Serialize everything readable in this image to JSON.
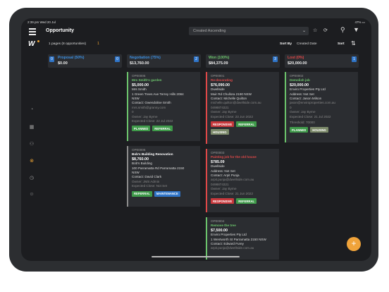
{
  "status": {
    "time_date": "2:39 pm  Wed 20 Jul",
    "right": "47% ▭"
  },
  "header": {
    "title": "Opportunity",
    "sort_select": "Created Ascending"
  },
  "subbar": {
    "pages": "1 pages (8 opportunities)",
    "count": "1",
    "sort_by_label": "Sort By",
    "sort_field": "Created Date",
    "sort_label": "Sort"
  },
  "columns": [
    {
      "name": "Proposal (50%)",
      "amount": "$0.00",
      "count_left": "0",
      "count_right": "0",
      "color": "#3c8fe0"
    },
    {
      "name": "Negotiation (75%)",
      "amount": "$13,760.00",
      "count_left": "",
      "count_right": "2",
      "color": "#3c8fe0"
    },
    {
      "name": "Won (100%)",
      "amount": "$84,375.09",
      "count_left": "",
      "count_right": "3",
      "color": "#6cc46c"
    },
    {
      "name": "Lost (0%)",
      "amount": "$20,000.00",
      "count_left": "",
      "count_right": "1",
      "color": "#e04848"
    }
  ],
  "cards": {
    "c1": {
      "id": "OP00005",
      "title": "Mrs Smith's garden",
      "value": "$5,000.00",
      "l1": "Mrs Smith",
      "l2": "1 Green Trees Ave Terrey Hills 2084",
      "l3": "NSW",
      "l4": "Contact: Gwendoline Smith",
      "l5": "mrs.smith@granny.com",
      "l6": "0",
      "l7": "Owner: Jay Byrne",
      "l8": "Expected Close: 22 Jul 2022",
      "t1": "PLANNED",
      "t2": "REFERRAL"
    },
    "c2": {
      "id": "OP00006",
      "title": "Bob's Building Renovation",
      "value": "$8,760.00",
      "l1": "Bob's Building",
      "l2": "100 Parramatta Rd Parramatta 2150",
      "l3": "NSW",
      "l4": "Contact: David Clark",
      "l5": "Owner: JMS Admin",
      "l6": "Expected Close: Not Set",
      "t1": "REFERRAL",
      "t2": "MAINTENANCE"
    },
    "c3": {
      "id": "OP00001",
      "title": "Re-decorating",
      "value": "$76,090.00",
      "l1": "Dwellside",
      "l2": "Muir Rd Chullora 2190 NSW",
      "l3": "Contact: Michelle Quilton",
      "l4": "michelle.quilton@dwellside.com.au",
      "l5": "0498874321",
      "l6": "Owner: Jay Byrne",
      "l7": "Expected Close: 23 Jun 2022",
      "t1": "RESPONSIVE",
      "t2": "REFERRAL",
      "t3": "HOUSING"
    },
    "c4": {
      "id": "OP00003",
      "title": "Painting job for the old house",
      "value": "$785.09",
      "l1": "Dwellside",
      "l2": "Address: Not Set",
      "l3": "Contact: Arpit Punja",
      "l4": "arpit.punja@dwellside.com.au",
      "l5": "0498874321",
      "l6": "Owner: Jay Byrne",
      "l7": "Expected Close: 21 Jun 2022",
      "t1": "RESPONSIVE",
      "t2": "REFERRAL"
    },
    "c5": {
      "id": "OP00004",
      "title": "Remove the tree",
      "value": "$7,500.00",
      "l1": "Enviro Properties Pty Ltd",
      "l2": "1 Wentworth St Parramatta 2150 NSW",
      "l3": "Contact: Edward Furey",
      "l4": "arpit.punja@dwellside.com.au"
    },
    "c6": {
      "id": "OP00002",
      "title": "Demolish job",
      "value": "$20,000.00",
      "l1": "Enviro Properties Pty Ltd",
      "l2": "Address: Not Set",
      "l3": "Contact: Jason Milson",
      "l4": "jason@enviroproperties.com.au",
      "l5": "0",
      "l6": "Owner: Jay Byrne",
      "l7": "Expected Close: 21 Jul 2022",
      "l8": "Threshold: 70000",
      "t1": "PLANNED",
      "t2": "HOUSING"
    }
  },
  "colors": {
    "green": "#6cc46c",
    "red": "#e04848",
    "grey": "#8c8c8c",
    "accent": "#e8a033"
  }
}
